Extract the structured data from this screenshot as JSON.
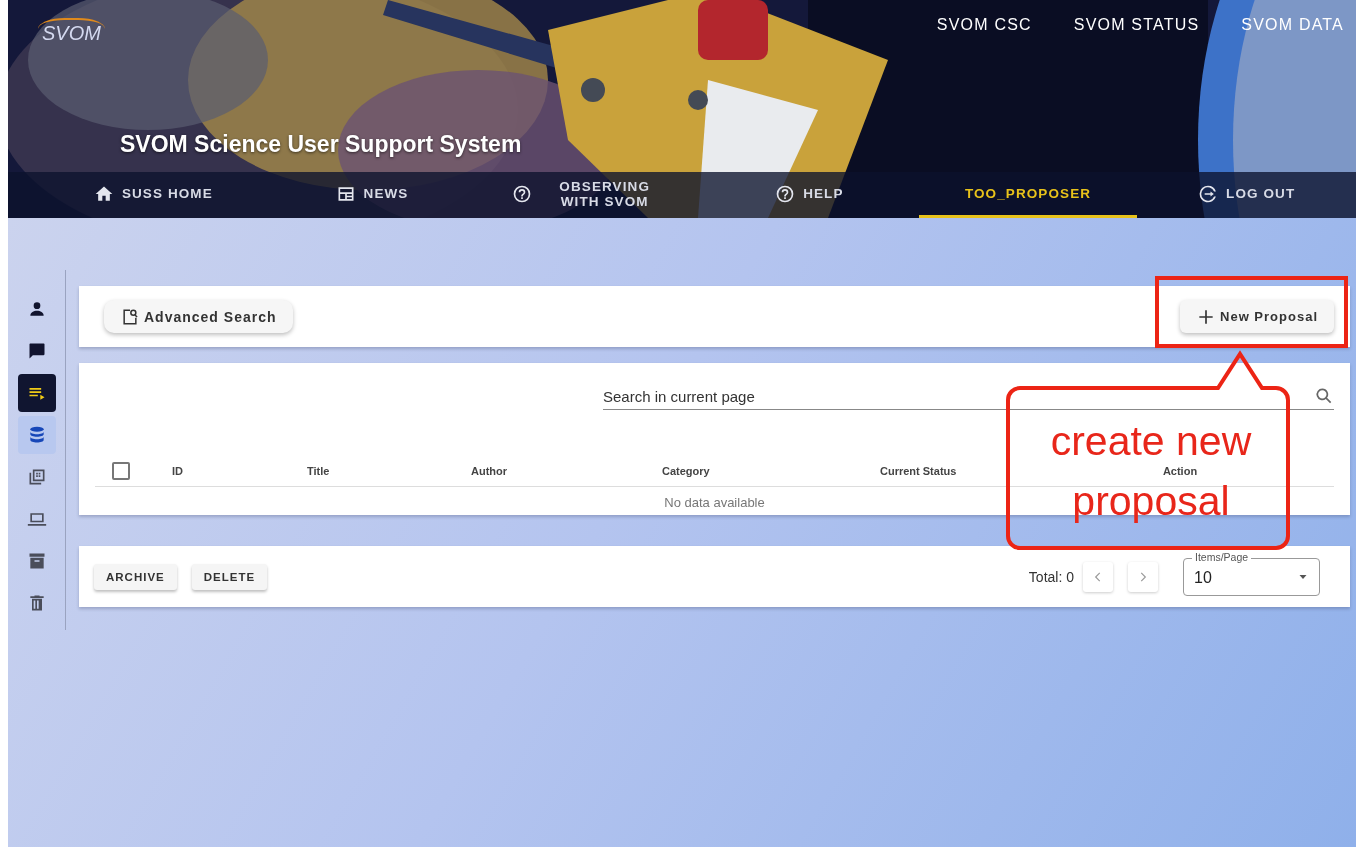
{
  "header": {
    "logo": "SVOM",
    "title": "SVOM Science User Support System",
    "top_links": [
      "SVOM CSC",
      "SVOM STATUS",
      "SVOM DATA"
    ]
  },
  "nav_tabs": [
    {
      "label": "SUSS HOME",
      "selected": false
    },
    {
      "label": "NEWS",
      "selected": false
    },
    {
      "label": "OBSERVING WITH SVOM",
      "selected": false
    },
    {
      "label": "HELP",
      "selected": false
    },
    {
      "label": "TOO_PROPOSER",
      "selected": true
    },
    {
      "label": "LOG OUT",
      "selected": false
    }
  ],
  "sidebar": {
    "items": [
      {
        "selected": false,
        "hovered": false
      },
      {
        "selected": false,
        "hovered": false
      },
      {
        "selected": true,
        "hovered": false
      },
      {
        "selected": false,
        "hovered": true
      },
      {
        "selected": false,
        "hovered": false
      },
      {
        "selected": false,
        "hovered": false
      },
      {
        "selected": false,
        "hovered": false
      },
      {
        "selected": false,
        "hovered": false
      }
    ]
  },
  "toolbar": {
    "advanced_search": "Advanced Search",
    "new_proposal": "New Proposal"
  },
  "table": {
    "search": {
      "placeholder": "Search in current page"
    },
    "select_all": {
      "checked": false
    },
    "columns": [
      "ID",
      "Title",
      "Author",
      "Category",
      "Current Status",
      "Action"
    ],
    "empty_message": "No data available"
  },
  "footer": {
    "buttons": [
      "ARCHIVE",
      "DELETE"
    ],
    "total": "Total: 0",
    "items_per_page": {
      "label": "Items/Page",
      "value": "10"
    }
  },
  "annotation": {
    "lines": [
      "create new",
      "proposal"
    ]
  }
}
